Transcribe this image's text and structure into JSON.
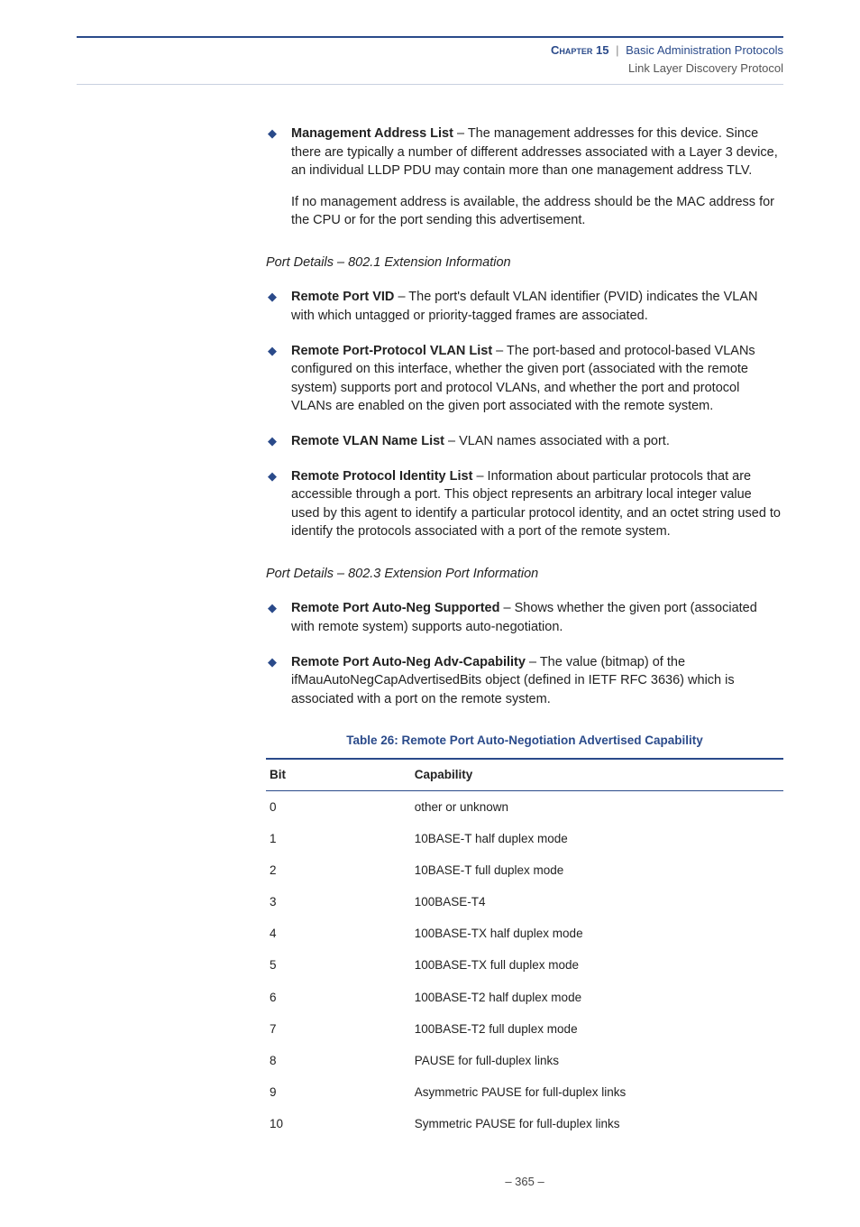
{
  "header": {
    "chapter_label": "Chapter 15",
    "separator": "|",
    "title": "Basic Administration Protocols",
    "subtitle": "Link Layer Discovery Protocol"
  },
  "bullets_top": [
    {
      "term": "Management Address List",
      "desc": " – The management addresses for this device. Since there are typically a number of different addresses associated with a Layer 3 device, an individual LLDP PDU may contain more than one management address TLV.",
      "follow": "If no management address is available, the address should be the MAC address for the CPU or for the port sending this advertisement."
    }
  ],
  "section1_heading": "Port Details – 802.1 Extension Information",
  "bullets_8021": [
    {
      "term": "Remote Port VID",
      "desc": " – The port's default VLAN identifier (PVID) indicates the VLAN with which untagged or priority-tagged frames are associated."
    },
    {
      "term": "Remote Port-Protocol VLAN List",
      "desc": " – The port-based and protocol-based VLANs configured on this interface, whether the given port (associated with the remote system) supports port and protocol VLANs, and whether the port and protocol VLANs are enabled on the given port associated with the remote system."
    },
    {
      "term": "Remote VLAN Name List",
      "desc": " – VLAN names associated with a port."
    },
    {
      "term": "Remote Protocol Identity List",
      "desc": " – Information about particular protocols that are accessible through a port. This object represents an arbitrary local integer value used by this agent to identify a particular protocol identity, and an octet string used to identify the protocols associated with a port of the remote system."
    }
  ],
  "section2_heading": "Port Details – 802.3 Extension Port Information",
  "bullets_8023": [
    {
      "term": "Remote Port Auto-Neg Supported",
      "desc": " – Shows whether the given port (associated with remote system) supports auto-negotiation."
    },
    {
      "term": "Remote Port Auto-Neg Adv-Capability",
      "desc": " – The value (bitmap) of the ifMauAutoNegCapAdvertisedBits object (defined in IETF RFC 3636) which is associated with a port on the remote system."
    }
  ],
  "table": {
    "title": "Table 26: Remote Port Auto-Negotiation Advertised Capability",
    "col1": "Bit",
    "col2": "Capability",
    "rows": [
      {
        "bit": "0",
        "cap": "other or unknown"
      },
      {
        "bit": "1",
        "cap": "10BASE-T  half duplex mode"
      },
      {
        "bit": "2",
        "cap": "10BASE-T  full duplex mode"
      },
      {
        "bit": "3",
        "cap": "100BASE-T4"
      },
      {
        "bit": "4",
        "cap": "100BASE-TX half duplex mode"
      },
      {
        "bit": "5",
        "cap": "100BASE-TX full duplex mode"
      },
      {
        "bit": "6",
        "cap": "100BASE-T2 half duplex mode"
      },
      {
        "bit": "7",
        "cap": "100BASE-T2 full duplex mode"
      },
      {
        "bit": "8",
        "cap": "PAUSE for full-duplex links"
      },
      {
        "bit": "9",
        "cap": "Asymmetric PAUSE for full-duplex links"
      },
      {
        "bit": "10",
        "cap": "Symmetric PAUSE for full-duplex links"
      }
    ]
  },
  "page_number": "–  365  –"
}
